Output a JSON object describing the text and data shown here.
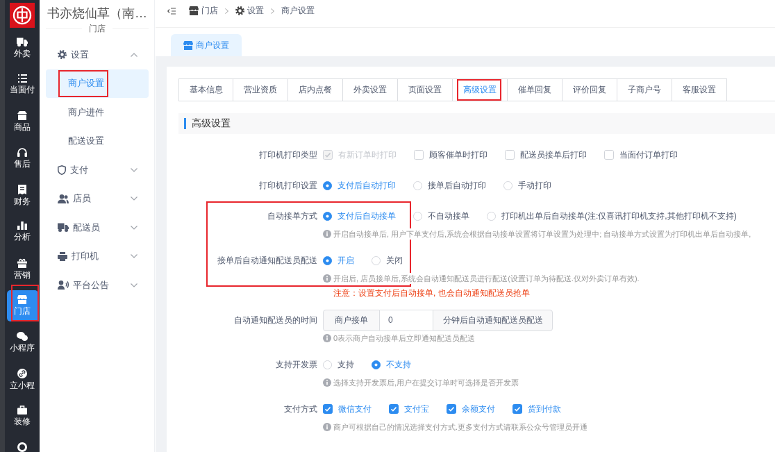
{
  "app_sidebar": {
    "items": [
      {
        "label": "外卖",
        "selected": false,
        "highlighted": false
      },
      {
        "label": "当面付",
        "selected": false,
        "highlighted": false
      },
      {
        "label": "商品",
        "selected": false,
        "highlighted": false
      },
      {
        "label": "售后",
        "selected": false,
        "highlighted": false
      },
      {
        "label": "财务",
        "selected": false,
        "highlighted": false
      },
      {
        "label": "分析",
        "selected": false,
        "highlighted": false
      },
      {
        "label": "营销",
        "selected": false,
        "highlighted": false
      },
      {
        "label": "门店",
        "selected": true,
        "highlighted": true
      },
      {
        "label": "小程序",
        "selected": false,
        "highlighted": false
      },
      {
        "label": "立小程",
        "selected": false,
        "highlighted": false
      },
      {
        "label": "装修",
        "selected": false,
        "highlighted": false
      },
      {
        "selected": false,
        "highlighted": false
      }
    ]
  },
  "store_menu": {
    "title": "书亦烧仙草（南…",
    "subtitle": "门店",
    "groups": [
      {
        "label": "设置",
        "expanded": true,
        "children": [
          {
            "label": "商户设置",
            "selected": true,
            "highlighted": true
          },
          {
            "label": "商户进件",
            "selected": false,
            "highlighted": false
          },
          {
            "label": "配送设置",
            "selected": false,
            "highlighted": false
          }
        ]
      },
      {
        "label": "支付",
        "expanded": false
      },
      {
        "label": "店员",
        "expanded": false
      },
      {
        "label": "配送员",
        "expanded": false
      },
      {
        "label": "打印机",
        "expanded": false
      },
      {
        "label": "平台公告",
        "expanded": false
      }
    ]
  },
  "breadcrumb": {
    "items": [
      "门店",
      "设置",
      "商户设置"
    ]
  },
  "page_tabs": [
    {
      "label": "商户设置",
      "selected": true
    }
  ],
  "settings_tabs": [
    {
      "label": "基本信息",
      "selected": false,
      "highlighted": false
    },
    {
      "label": "营业资质",
      "selected": false,
      "highlighted": false
    },
    {
      "label": "店内点餐",
      "selected": false,
      "highlighted": false
    },
    {
      "label": "外卖设置",
      "selected": false,
      "highlighted": false
    },
    {
      "label": "页面设置",
      "selected": false,
      "highlighted": false
    },
    {
      "label": "高级设置",
      "selected": true,
      "highlighted": true
    },
    {
      "label": "催单回复",
      "selected": false,
      "highlighted": false
    },
    {
      "label": "评价回复",
      "selected": false,
      "highlighted": false
    },
    {
      "label": "子商户号",
      "selected": false,
      "highlighted": false
    },
    {
      "label": "客服设置",
      "selected": false,
      "highlighted": false
    }
  ],
  "section_title": "高级设置",
  "form": [
    {
      "kind": "checkboxes",
      "label": "打印机打印类型",
      "highlighted": false,
      "options": [
        {
          "label": "有新订单时打印",
          "checked": true,
          "disabled": true
        },
        {
          "label": "顾客催单时打印",
          "checked": false,
          "disabled": false
        },
        {
          "label": "配送员接单后打印",
          "checked": false,
          "disabled": false
        },
        {
          "label": "当面付订单打印",
          "checked": false,
          "disabled": false
        }
      ]
    },
    {
      "kind": "radios",
      "label": "打印机打印设置",
      "highlighted": false,
      "options": [
        {
          "label": "支付后自动打印",
          "selected": true
        },
        {
          "label": "接单后自动打印",
          "selected": false
        },
        {
          "label": "手动打印",
          "selected": false
        }
      ]
    },
    {
      "kind": "radios",
      "label": "自动接单方式",
      "highlighted": true,
      "options": [
        {
          "label": "支付后自动接单",
          "selected": true
        },
        {
          "label": "不自动接单",
          "selected": false
        },
        {
          "label": "打印机出单后自动接单(注:仅喜讯打印机支持,其他打印机不支持)",
          "selected": false
        }
      ],
      "hint": "开启自动接单后, 用户下单支付后,系统会根据自动接单设置将订单设置为处理中; 自动接单方式设置为打印机出单后自动接单,"
    },
    {
      "kind": "radios",
      "label": "接单后自动通知配送员配送",
      "highlighted": true,
      "options": [
        {
          "label": "开启",
          "selected": true
        },
        {
          "label": "关闭",
          "selected": false
        }
      ],
      "hint": "开启后, 店员接单后,系统会自动通知配送员进行配送(设置订单为待配送.仅对外卖订单有效).",
      "note": "注意：设置支付后自动接单, 也会自动通知配送员抢单"
    },
    {
      "kind": "input_group",
      "label": "自动通知配送员的时间",
      "highlighted": false,
      "prefix": "商户接单",
      "value": "0",
      "suffix": "分钟后自动通知配送员配送",
      "hint": "0表示商户自动接单后立即通知配送员配送"
    },
    {
      "kind": "radios",
      "label": "支持开发票",
      "highlighted": false,
      "options": [
        {
          "label": "支持",
          "selected": false
        },
        {
          "label": "不支持",
          "selected": true
        }
      ],
      "hint": "选择支持开发票后,用户在提交订单时可选择是否开发票"
    },
    {
      "kind": "checkboxes",
      "label": "支付方式",
      "highlighted": false,
      "options": [
        {
          "label": "微信支付",
          "checked": true,
          "disabled": false
        },
        {
          "label": "支付宝",
          "checked": true,
          "disabled": false
        },
        {
          "label": "余额支付",
          "checked": true,
          "disabled": false
        },
        {
          "label": "货到付款",
          "checked": true,
          "disabled": false
        }
      ],
      "hint": "商户可根据自己的情况选择支付方式.更多支付方式请联系公众号管理员开通"
    }
  ]
}
